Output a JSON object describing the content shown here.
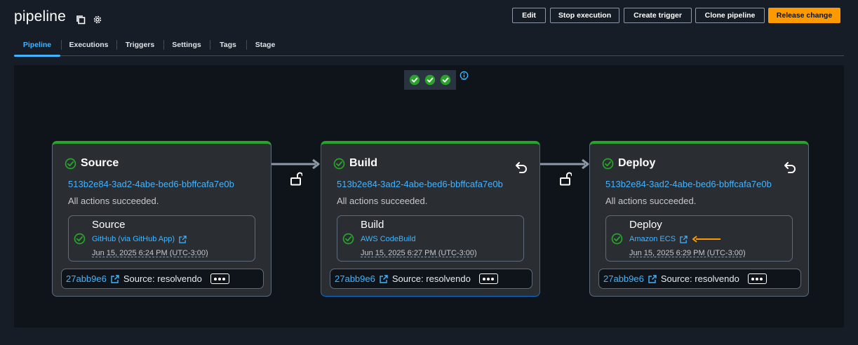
{
  "app": {
    "title": "pipeline"
  },
  "toolbar": {
    "edit": "Edit",
    "stop_execution": "Stop execution",
    "create_trigger": "Create trigger",
    "clone_pipeline": "Clone pipeline",
    "release_change": "Release change"
  },
  "tabs": [
    "Pipeline",
    "Executions",
    "Triggers",
    "Settings",
    "Tags",
    "Stage"
  ],
  "active_tab": "Pipeline",
  "colors": {
    "accent": "#ff9900",
    "link": "#42b4ff",
    "success": "#29a329",
    "selected_border": "#0972d3"
  },
  "icons": {
    "copy": "copy-icon",
    "settings": "gear-icon",
    "success": "check-circle-icon",
    "retry": "undo-icon",
    "transition": "unlock-icon",
    "external": "external-link-icon",
    "info": "info-icon"
  },
  "stages": [
    {
      "name": "Source",
      "execution_id": "513b2e84-3ad2-4abe-bed6-bbffcafa7e0b",
      "status": "All actions succeeded.",
      "action": {
        "name": "Source",
        "provider": "GitHub (via GitHub App)",
        "time": "Jun 15, 2025 6:24 PM (UTC-3:00)"
      },
      "commit": {
        "id": "27abb9e6",
        "message": "Source: resolvendo"
      }
    },
    {
      "name": "Build",
      "execution_id": "513b2e84-3ad2-4abe-bed6-bbffcafa7e0b",
      "status": "All actions succeeded.",
      "action": {
        "name": "Build",
        "provider": "AWS CodeBuild",
        "time": "Jun 15, 2025 6:27 PM (UTC-3:00)"
      },
      "commit": {
        "id": "27abb9e6",
        "message": "Source: resolvendo"
      }
    },
    {
      "name": "Deploy",
      "execution_id": "513b2e84-3ad2-4abe-bed6-bbffcafa7e0b",
      "status": "All actions succeeded.",
      "action": {
        "name": "Deploy",
        "provider": "Amazon ECS",
        "time": "Jun 15, 2025 6:29 PM (UTC-3:00)"
      },
      "commit": {
        "id": "27abb9e6",
        "message": "Source: resolvendo"
      }
    }
  ]
}
